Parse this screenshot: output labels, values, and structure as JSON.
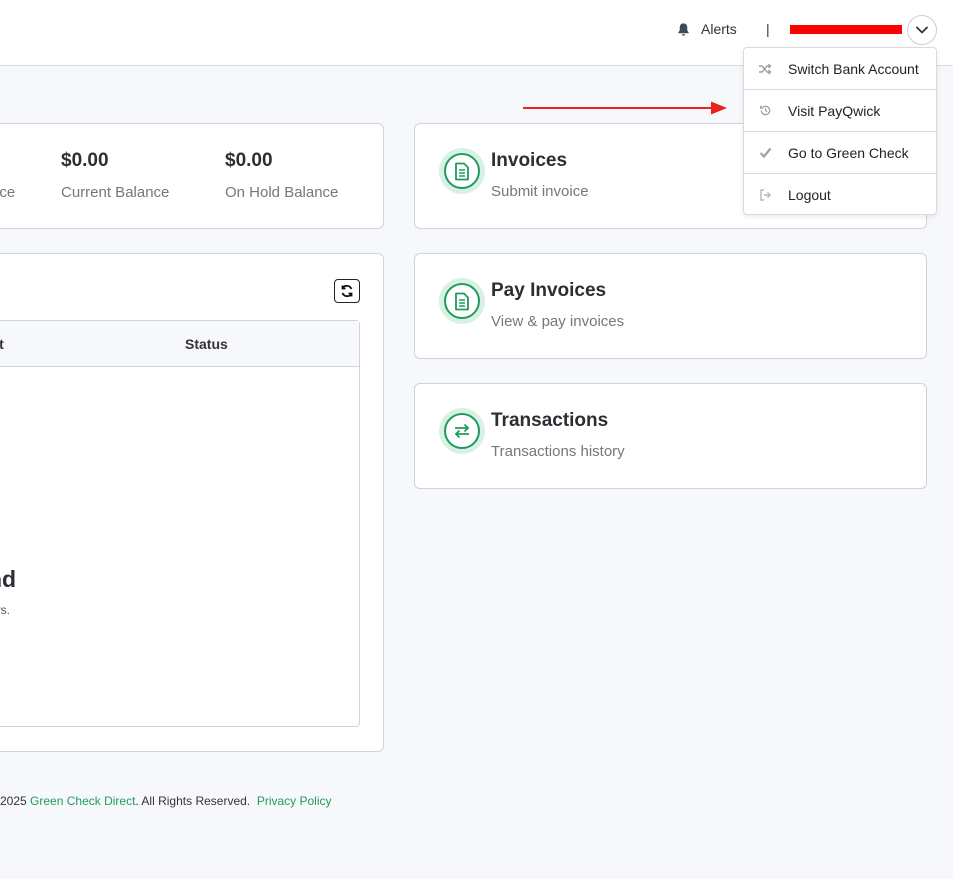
{
  "header": {
    "alerts_label": "Alerts",
    "separator": "|",
    "menu_toggle_icon": "chevron-down-icon"
  },
  "user_menu": {
    "items": [
      {
        "label": "Switch Bank Account",
        "icon": "shuffle-icon"
      },
      {
        "label": "Visit PayQwick",
        "icon": "history-icon"
      },
      {
        "label": "Go to Green Check",
        "icon": "check-icon"
      },
      {
        "label": "Logout",
        "icon": "logout-icon"
      }
    ]
  },
  "balances": {
    "first_label_partial": "nce",
    "current_value": "$0.00",
    "current_label": "Current Balance",
    "onhold_value": "$0.00",
    "onhold_label": "On Hold Balance"
  },
  "transactions_table": {
    "columns": [
      "unt",
      "Status"
    ],
    "empty_title": "nd",
    "empty_subtitle": "ays."
  },
  "actions": [
    {
      "title": "Invoices",
      "subtitle": "Submit invoice",
      "icon": "document-icon"
    },
    {
      "title": "Pay Invoices",
      "subtitle": "View & pay invoices",
      "icon": "document-icon"
    },
    {
      "title": "Transactions",
      "subtitle": "Transactions history",
      "icon": "exchange-icon"
    }
  ],
  "footer": {
    "copyright_prefix": "2025",
    "company_link": "Green Check Direct",
    "rights_text": ". All Rights Reserved.",
    "privacy_link": "Privacy Policy"
  },
  "colors": {
    "brand_green": "#1f9b5d",
    "icon_bg": "#d9f1e4",
    "annotation_red": "#e8231c",
    "page_bg": "#f7f8fb"
  }
}
